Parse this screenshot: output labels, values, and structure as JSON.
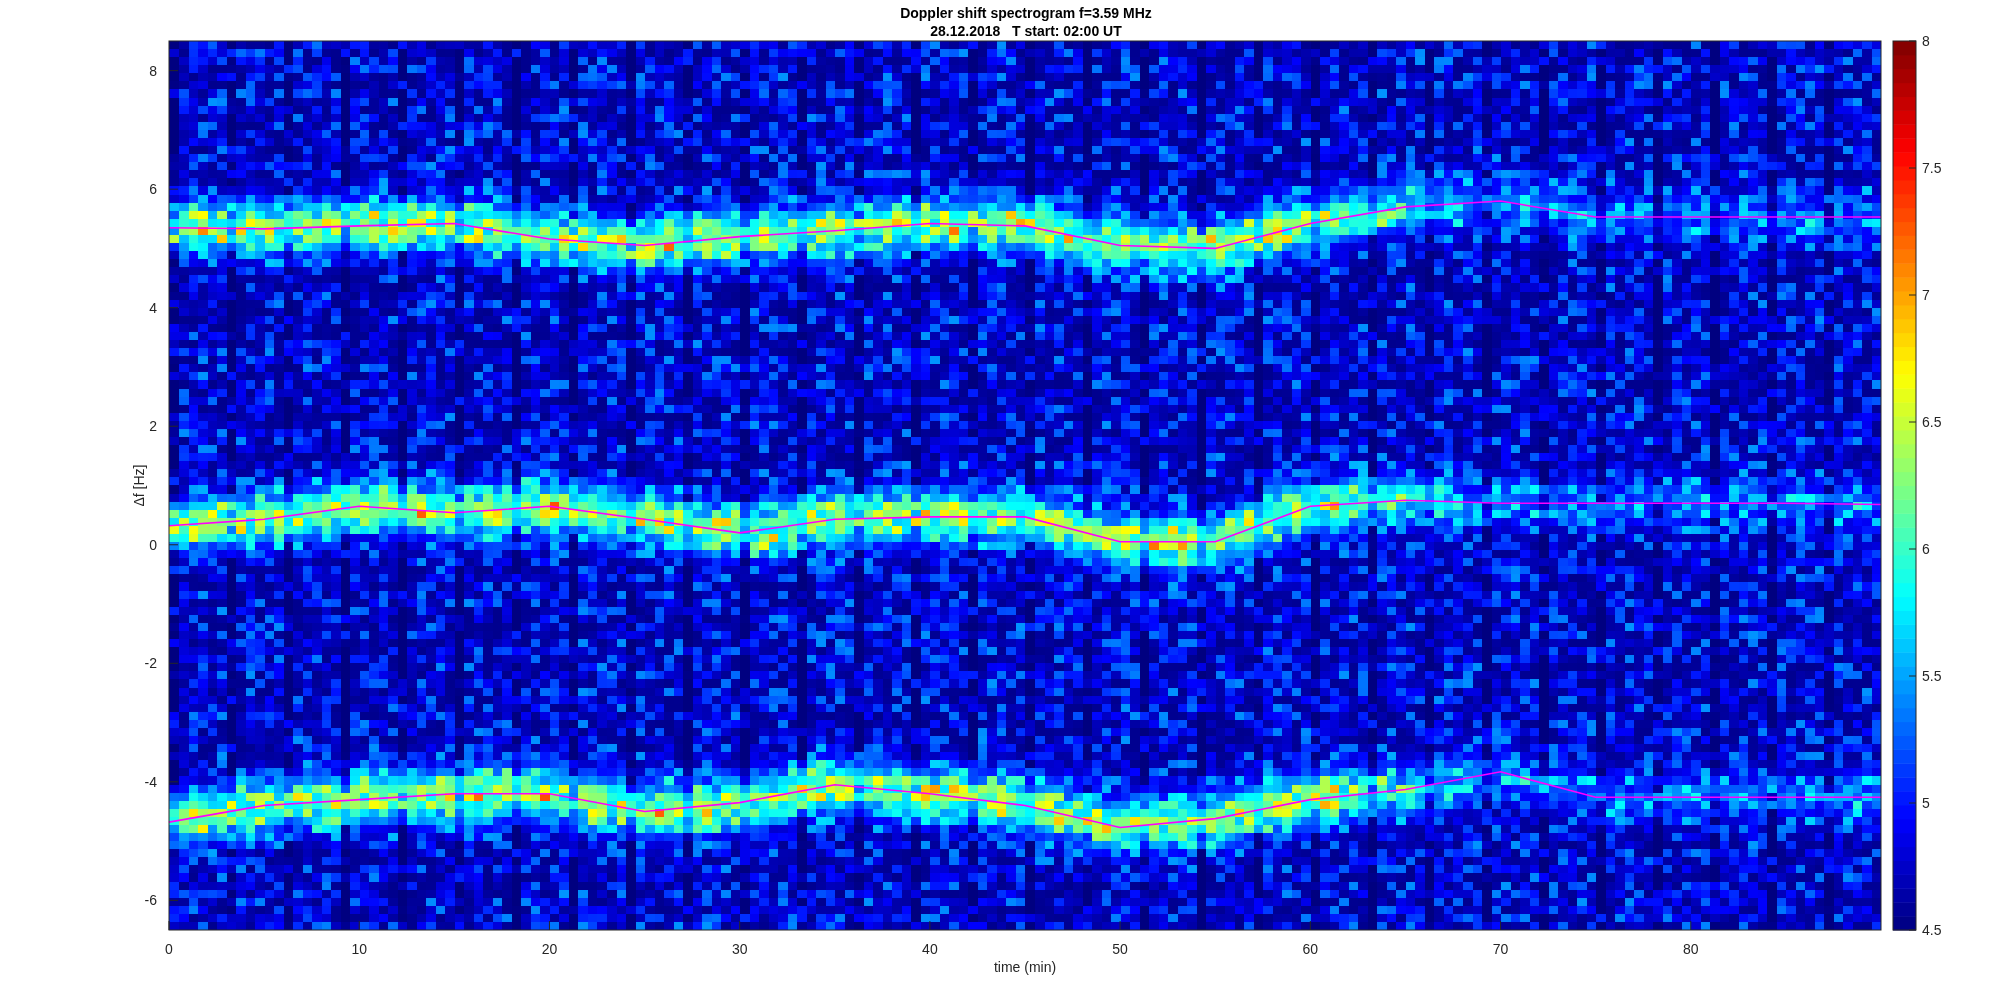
{
  "figure": {
    "title": "Doppler shift spectrogram f=3.59 MHz",
    "subtitle": "28.12.2018   T start: 02:00 UT",
    "chart_data": {
      "type": "line",
      "xlabel": "time (min)",
      "ylabel": "Δf [Hz]",
      "x": [
        0,
        5,
        10,
        15,
        20,
        25,
        30,
        35,
        40,
        45,
        50,
        55,
        60,
        65,
        70,
        75,
        80,
        85,
        90
      ],
      "series": [
        {
          "color": "#ff00ff",
          "values": [
            5.35,
            5.33,
            5.38,
            5.42,
            5.16,
            5.05,
            5.2,
            5.3,
            5.42,
            5.38,
            5.05,
            5.0,
            5.42,
            5.7,
            5.8,
            5.53,
            5.53,
            5.53,
            5.53
          ]
        },
        {
          "color": "#ff00ff",
          "values": [
            0.32,
            0.43,
            0.65,
            0.54,
            0.65,
            0.43,
            0.2,
            0.43,
            0.47,
            0.47,
            0.05,
            0.05,
            0.65,
            0.75,
            0.7,
            0.7,
            0.7,
            0.7,
            0.68
          ]
        },
        {
          "color": "#ff00ff",
          "values": [
            -4.68,
            -4.4,
            -4.3,
            -4.2,
            -4.2,
            -4.5,
            -4.35,
            -4.05,
            -4.2,
            -4.4,
            -4.77,
            -4.62,
            -4.3,
            -4.13,
            -3.83,
            -4.26,
            -4.26,
            -4.26,
            -4.26
          ]
        }
      ],
      "xlim": [
        0,
        90
      ],
      "ylim": [
        -6.5,
        8.5
      ],
      "xticks": [
        0,
        10,
        20,
        30,
        40,
        50,
        60,
        70,
        80
      ],
      "yticks": [
        -6,
        -4,
        -2,
        0,
        2,
        4,
        6,
        8
      ]
    }
  },
  "colorbar": {
    "ticks": [
      "8",
      "7.5",
      "7",
      "6.5",
      "6",
      "5.5",
      "5",
      "4.5"
    ]
  }
}
